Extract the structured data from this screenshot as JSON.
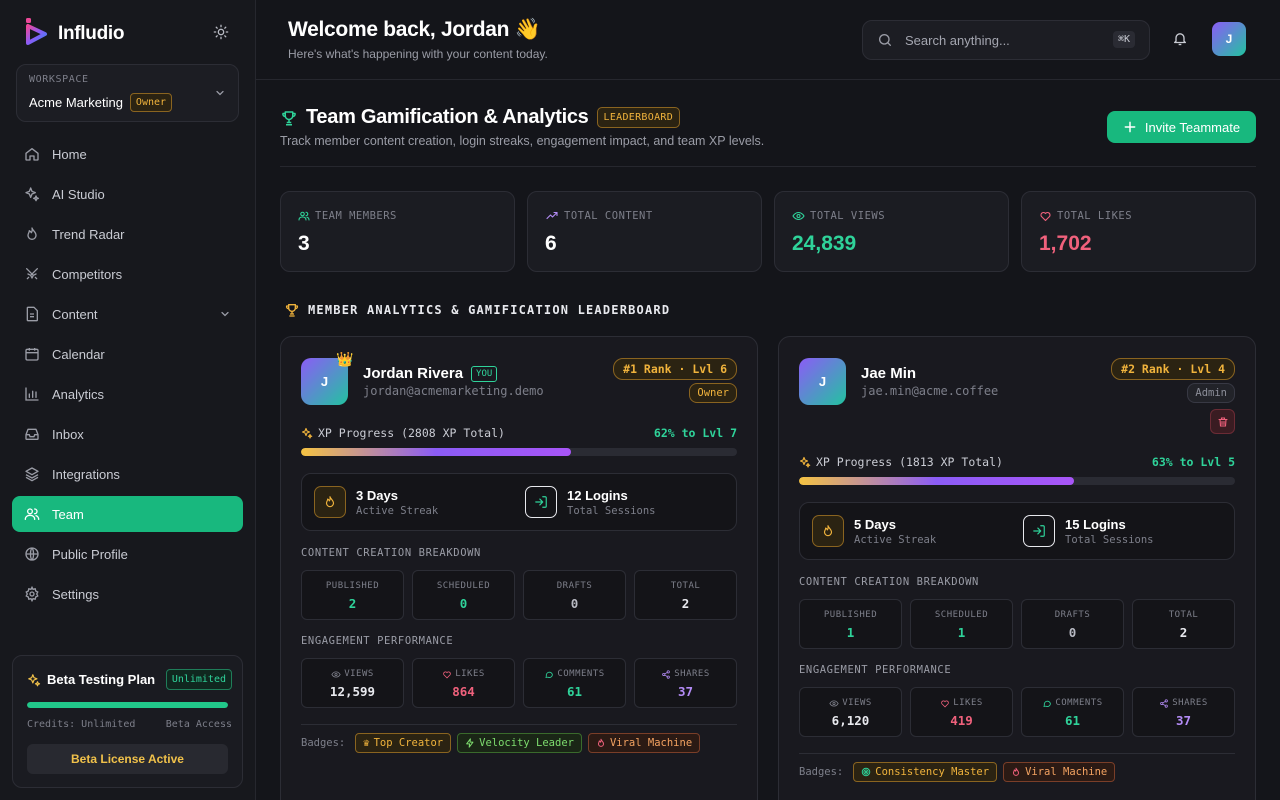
{
  "brand": {
    "name": "Infludio"
  },
  "workspace": {
    "label": "WORKSPACE",
    "name": "Acme Marketing",
    "role": "Owner"
  },
  "nav": [
    {
      "label": "Home",
      "icon": "home-icon"
    },
    {
      "label": "AI Studio",
      "icon": "sparkles-icon"
    },
    {
      "label": "Trend Radar",
      "icon": "flame-icon"
    },
    {
      "label": "Competitors",
      "icon": "swords-icon"
    },
    {
      "label": "Content",
      "icon": "document-icon"
    },
    {
      "label": "Calendar",
      "icon": "calendar-icon"
    },
    {
      "label": "Analytics",
      "icon": "bar-chart-icon"
    },
    {
      "label": "Inbox",
      "icon": "inbox-icon"
    },
    {
      "label": "Integrations",
      "icon": "layers-icon"
    },
    {
      "label": "Team",
      "icon": "users-icon",
      "active": true
    },
    {
      "label": "Public Profile",
      "icon": "globe-icon"
    },
    {
      "label": "Settings",
      "icon": "gear-icon"
    }
  ],
  "plan": {
    "title": "Beta Testing Plan",
    "tag": "Unlimited",
    "progress": 1.0,
    "credits": "Credits: Unlimited",
    "access": "Beta Access",
    "button": "Beta License Active"
  },
  "header": {
    "welcome": "Welcome back, Jordan 👋",
    "subtitle": "Here's what's happening with your content today.",
    "search_placeholder": "Search anything...",
    "shortcut": "⌘K",
    "avatar_initial": "J"
  },
  "section": {
    "title": "Team Gamification & Analytics",
    "tag": "LEADERBOARD",
    "description": "Track member content creation, login streaks, engagement impact, and team XP levels.",
    "invite_label": "Invite Teammate"
  },
  "stats": [
    {
      "label": "TEAM MEMBERS",
      "value": "3",
      "color": "#ffffff",
      "icon": "users-icon",
      "icon_color": "#2fd39a"
    },
    {
      "label": "TOTAL CONTENT",
      "value": "6",
      "color": "#ffffff",
      "icon": "trending-up-icon",
      "icon_color": "#b48cf7"
    },
    {
      "label": "TOTAL VIEWS",
      "value": "24,839",
      "color": "#2fd39a",
      "icon": "eye-icon",
      "icon_color": "#2fd39a"
    },
    {
      "label": "TOTAL LIKES",
      "value": "1,702",
      "color": "#f0617c",
      "icon": "heart-icon",
      "icon_color": "#f0617c"
    }
  ],
  "leaderboard_title": "MEMBER ANALYTICS & GAMIFICATION LEADERBOARD",
  "labels": {
    "content_breakdown": "CONTENT CREATION BREAKDOWN",
    "engagement": "ENGAGEMENT PERFORMANCE",
    "badges": "Badges:",
    "published": "PUBLISHED",
    "scheduled": "SCHEDULED",
    "drafts": "DRAFTS",
    "total": "TOTAL",
    "views": "VIEWS",
    "likes": "LIKES",
    "comments": "COMMENTS",
    "shares": "SHARES"
  },
  "members": [
    {
      "initial": "J",
      "name": "Jordan Rivera",
      "you": "YOU",
      "email": "jordan@acmemarketing.demo",
      "rank": "#1 Rank · Lvl 6",
      "role": "Owner",
      "xp_label": "XP Progress (2808 XP Total)",
      "xp_pct": "62% to Lvl 7",
      "xp_progress": 0.62,
      "streak_main": "3 Days",
      "streak_sub": "Active Streak",
      "logins_main": "12 Logins",
      "logins_sub": "Total Sessions",
      "published": "2",
      "scheduled": "0",
      "drafts": "0",
      "total": "2",
      "views": "12,599",
      "likes": "864",
      "comments": "61",
      "shares": "37",
      "badges": [
        {
          "label": "Top Creator",
          "style": "gold",
          "icon": "crown-icon"
        },
        {
          "label": "Velocity Leader",
          "style": "green",
          "icon": "lightning-icon"
        },
        {
          "label": "Viral Machine",
          "style": "red",
          "icon": "flame-icon"
        }
      ]
    },
    {
      "initial": "J",
      "name": "Jae Min",
      "email": "jae.min@acme.coffee",
      "rank": "#2 Rank · Lvl 4",
      "role": "Admin",
      "xp_label": "XP Progress (1813 XP Total)",
      "xp_pct": "63% to Lvl 5",
      "xp_progress": 0.63,
      "streak_main": "5 Days",
      "streak_sub": "Active Streak",
      "logins_main": "15 Logins",
      "logins_sub": "Total Sessions",
      "published": "1",
      "scheduled": "1",
      "drafts": "0",
      "total": "2",
      "views": "6,120",
      "likes": "419",
      "comments": "61",
      "shares": "37",
      "badges": [
        {
          "label": "Consistency Master",
          "style": "gold",
          "icon": "target-icon"
        },
        {
          "label": "Viral Machine",
          "style": "red",
          "icon": "flame-icon"
        }
      ]
    }
  ]
}
